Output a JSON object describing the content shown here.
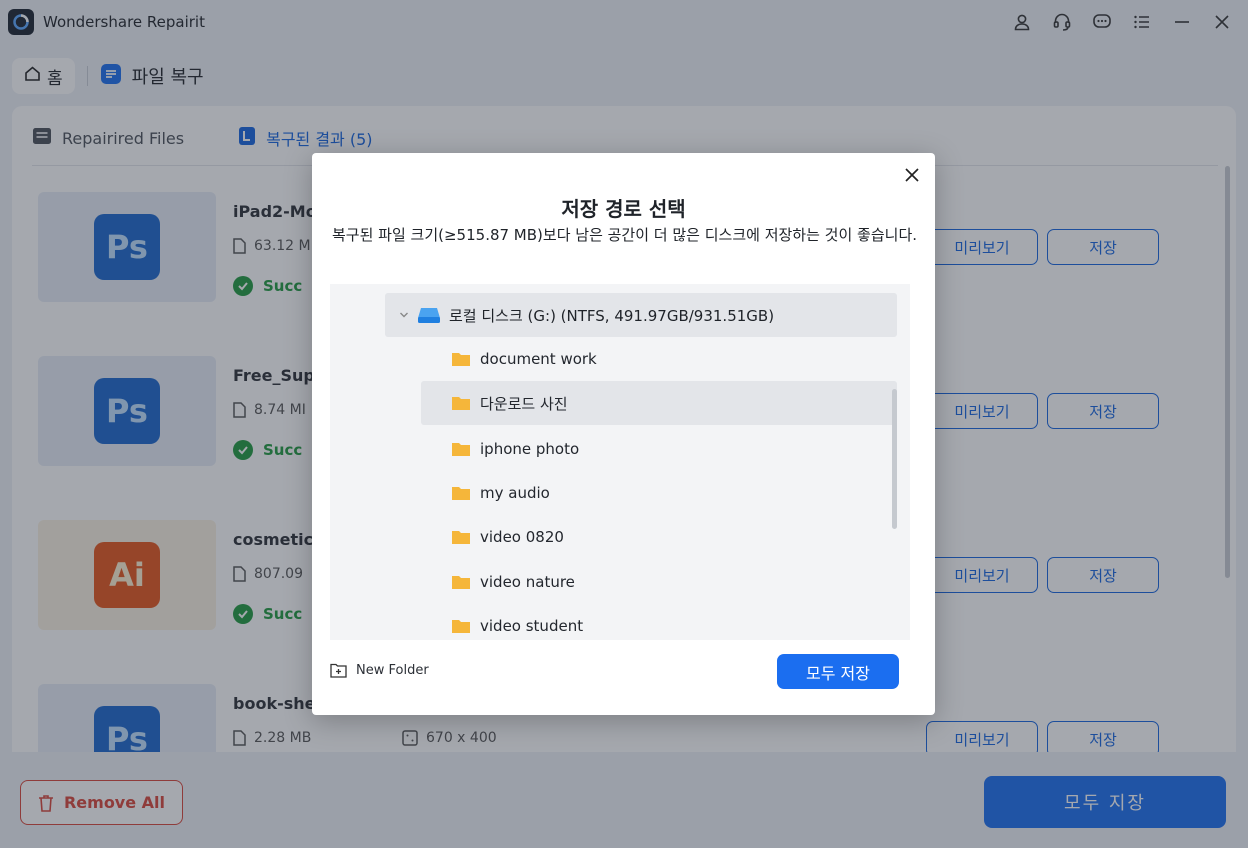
{
  "app": {
    "title": "Wondershare Repairit"
  },
  "breadcrumb": {
    "home": "홈",
    "current": "파일 복구"
  },
  "tabs": [
    {
      "label": "Repairired Files"
    },
    {
      "label": "복구된 결과 (5)"
    }
  ],
  "files": [
    {
      "name": "iPad2-Mo",
      "size": "63.12 M",
      "dims": "",
      "status": "Succ",
      "type": "Ps"
    },
    {
      "name": "Free_Supe",
      "size": "8.74 MI",
      "dims": "",
      "status": "Succ",
      "type": "Ps"
    },
    {
      "name": "cosmetics",
      "size": "807.09",
      "dims": "",
      "status": "Succ",
      "type": "Ai"
    },
    {
      "name": "book-shel",
      "size": "2.28 MB",
      "dims": "670 x 400",
      "status": "",
      "type": "Ps"
    }
  ],
  "row_buttons": {
    "preview": "미리보기",
    "save": "저장"
  },
  "footer": {
    "remove_all": "Remove All",
    "save_all": "모두 지장"
  },
  "dialog": {
    "title": "저장 경로 선택",
    "description": "복구된 파일 크기(≥515.87 MB)보다 남은 공간이 더 많은 디스크에 저장하는 것이 좋습니다.",
    "drive": "로컬 디스크 (G:) (NTFS, 491.97GB/931.51GB)",
    "folders": [
      "document work",
      "다운로드 사진",
      "iphone photo",
      "my audio",
      "video 0820",
      "video nature",
      "video student"
    ],
    "selected_folder": "다운로드 사진",
    "new_folder": "New Folder",
    "save_all": "모두 저장"
  },
  "colors": {
    "accent": "#1b6ef0",
    "success": "#1f9a3e",
    "danger": "#d9463a",
    "folder": "#f5b63a"
  }
}
